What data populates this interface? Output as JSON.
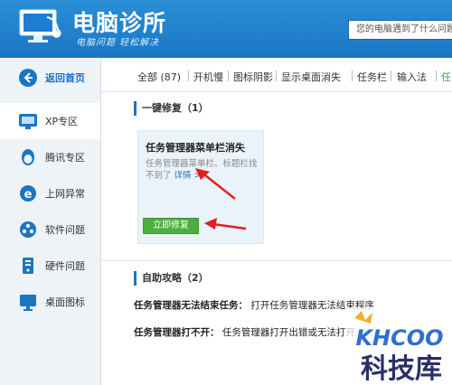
{
  "app": {
    "title": "电脑诊所",
    "subtitle": "电脑问题 轻松解决",
    "search_placeholder": "您的电脑遇到了什么问题"
  },
  "sidebar": {
    "items": [
      {
        "label": "返回首页",
        "icon": "back-arrow-icon"
      },
      {
        "label": "XP专区",
        "icon": "xp-icon"
      },
      {
        "label": "腾讯专区",
        "icon": "qq-icon"
      },
      {
        "label": "上网异常",
        "icon": "ie-icon"
      },
      {
        "label": "软件问题",
        "icon": "software-icon"
      },
      {
        "label": "硬件问题",
        "icon": "hardware-icon"
      },
      {
        "label": "桌面图标",
        "icon": "desktop-icon"
      }
    ]
  },
  "tabs": [
    {
      "label": "全部 (87)"
    },
    {
      "label": "开机慢"
    },
    {
      "label": "图标阴影"
    },
    {
      "label": "显示桌面消失"
    },
    {
      "label": "任务栏"
    },
    {
      "label": "输入法"
    },
    {
      "label": "任"
    }
  ],
  "one_click": {
    "heading": "一键修复（1）",
    "card_title": "任务管理器菜单栏消失",
    "card_desc": "任务管理器菜单栏、标题栏找不到了",
    "card_link": "详情 >",
    "fix_button": "立即修复"
  },
  "self_help": {
    "heading": "自助攻略（2）",
    "items": [
      {
        "title": "任务管理器无法结束任务：",
        "desc": "打开任务管理器无法结束程序"
      },
      {
        "title": "任务管理器打不开：",
        "desc": "任务管理器打开出错或无法打开"
      }
    ]
  },
  "watermark": {
    "brand": "KHCOO",
    "name": "科技库"
  },
  "colors": {
    "header": "#1a76c4",
    "accent_green": "#4cae3c",
    "arrow_red": "#e02020",
    "sidebar_bg": "#eef3f8"
  }
}
